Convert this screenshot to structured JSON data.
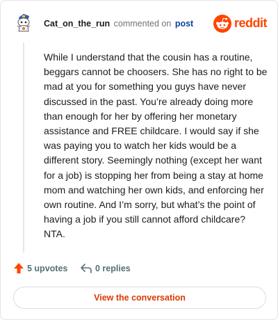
{
  "header": {
    "username": "Cat_on_the_run",
    "action_text": "commented on",
    "post_link_label": "post",
    "brand_name": "reddit"
  },
  "comment": {
    "body": "While I understand that the cousin has a routine, beggars cannot be choosers. She has no right to be mad at you for something you guys have never discussed in the past. You’re already doing more than enough for her by offering her monetary assistance and FREE childcare. I would say if she was paying you to watch her kids would be a different story. Seemingly nothing (except her want for a job) is stopping her from being a stay at home mom and watching her own kids, and enforcing her own routine. And I’m sorry, but what’s the point of having a job if you still cannot afford childcare? NTA."
  },
  "footer": {
    "upvotes_label": "5 upvotes",
    "replies_label": "0 replies",
    "view_button_label": "View the conversation"
  },
  "colors": {
    "brand": "#ff4500",
    "link": "#0a449b",
    "muted": "#576f76",
    "button_text": "#d93a00"
  },
  "icons": {
    "avatar": "snoo-avatar-icon",
    "logo": "reddit-logo-icon",
    "upvote": "upvote-arrow-icon",
    "reply": "reply-arrow-icon"
  }
}
